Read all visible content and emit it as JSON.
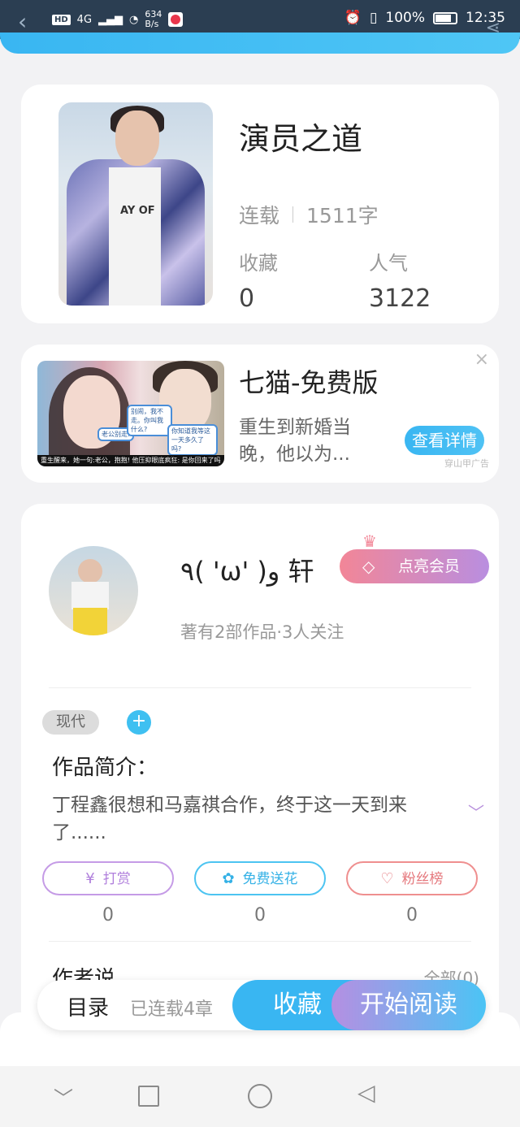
{
  "status_bar": {
    "network": "4G",
    "hd": "HD",
    "speed_value": "634",
    "speed_unit": "B/s",
    "battery_percent": "100%",
    "time": "12:35"
  },
  "book": {
    "title": "演员之道",
    "status": "连载",
    "word_count": "1511字",
    "favorites_label": "收藏",
    "favorites_value": "0",
    "popularity_label": "人气",
    "popularity_value": "3122",
    "cover_text": "AY OF"
  },
  "ad": {
    "title": "七猫-免费版",
    "description": "重生到新婚当晚，他以为...",
    "button": "查看详情",
    "source": "穿山甲广告",
    "close": "×",
    "bubble1": "老公别走!",
    "bubble2": "别闹，我不走。你叫我什么?",
    "bubble3": "你知道我等这一天多久了吗?",
    "strip": "重生醒来，她一句:老公，抱抱! 他压抑眼底疯狂: 是你回来了吗"
  },
  "author": {
    "name": "٩( 'ω' )و 轩",
    "vip_button": "点亮会员",
    "summary": "著有2部作品·3人关注"
  },
  "tags": [
    "现代"
  ],
  "tag_add": "+",
  "intro": {
    "title": "作品简介：",
    "text": "丁程鑫很想和马嘉祺合作，终于这一天到来了......"
  },
  "actions": [
    {
      "label": "打赏",
      "count": "0"
    },
    {
      "label": "免费送花",
      "count": "0"
    },
    {
      "label": "粉丝榜",
      "count": "0"
    }
  ],
  "author_says": {
    "title": "作者说",
    "all": "全部(0)"
  },
  "bottom_bar": {
    "toc": "目录",
    "serial": "已连载4章",
    "favorite": "收藏",
    "start_reading": "开始阅读"
  },
  "colors": {
    "accent_blue": "#39b6f2",
    "purple": "#b58fe2",
    "pink": "#f28697"
  }
}
